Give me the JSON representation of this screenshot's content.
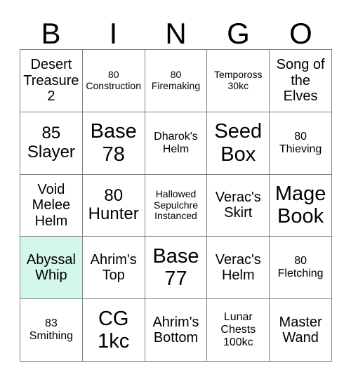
{
  "card": {
    "title_letters": [
      "B",
      "I",
      "N",
      "G",
      "O"
    ],
    "marked_color": "#d4f7ec",
    "border_color": "#808080",
    "text_color": "#000000",
    "background_color": "#ffffff",
    "rows": 5,
    "columns": 5,
    "cells": [
      {
        "text": "Desert Treasure 2",
        "size": "md",
        "marked": false
      },
      {
        "text": "80 Construction",
        "size": "xs",
        "marked": false
      },
      {
        "text": "80 Firemaking",
        "size": "xs",
        "marked": false
      },
      {
        "text": "Tempoross 30kc",
        "size": "xs",
        "marked": false
      },
      {
        "text": "Song of the Elves",
        "size": "md",
        "marked": false
      },
      {
        "text": "85 Slayer",
        "size": "lg",
        "marked": false
      },
      {
        "text": "Base 78",
        "size": "xl",
        "marked": false
      },
      {
        "text": "Dharok's Helm",
        "size": "sm",
        "marked": false
      },
      {
        "text": "Seed Box",
        "size": "xl",
        "marked": false
      },
      {
        "text": "80 Thieving",
        "size": "sm",
        "marked": false
      },
      {
        "text": "Void Melee Helm",
        "size": "md",
        "marked": false
      },
      {
        "text": "80 Hunter",
        "size": "lg",
        "marked": false
      },
      {
        "text": "Hallowed Sepulchre Instanced",
        "size": "xs",
        "marked": false
      },
      {
        "text": "Verac's Skirt",
        "size": "md",
        "marked": false
      },
      {
        "text": "Mage Book",
        "size": "xl",
        "marked": false
      },
      {
        "text": "Abyssal Whip",
        "size": "md",
        "marked": true
      },
      {
        "text": "Ahrim's Top",
        "size": "md",
        "marked": false
      },
      {
        "text": "Base 77",
        "size": "xl",
        "marked": false
      },
      {
        "text": "Verac's Helm",
        "size": "md",
        "marked": false
      },
      {
        "text": "80 Fletching",
        "size": "sm",
        "marked": false
      },
      {
        "text": "83 Smithing",
        "size": "sm",
        "marked": false
      },
      {
        "text": "CG 1kc",
        "size": "xl",
        "marked": false
      },
      {
        "text": "Ahrim's Bottom",
        "size": "md",
        "marked": false
      },
      {
        "text": "Lunar Chests 100kc",
        "size": "sm",
        "marked": false
      },
      {
        "text": "Master Wand",
        "size": "md",
        "marked": false
      }
    ]
  }
}
